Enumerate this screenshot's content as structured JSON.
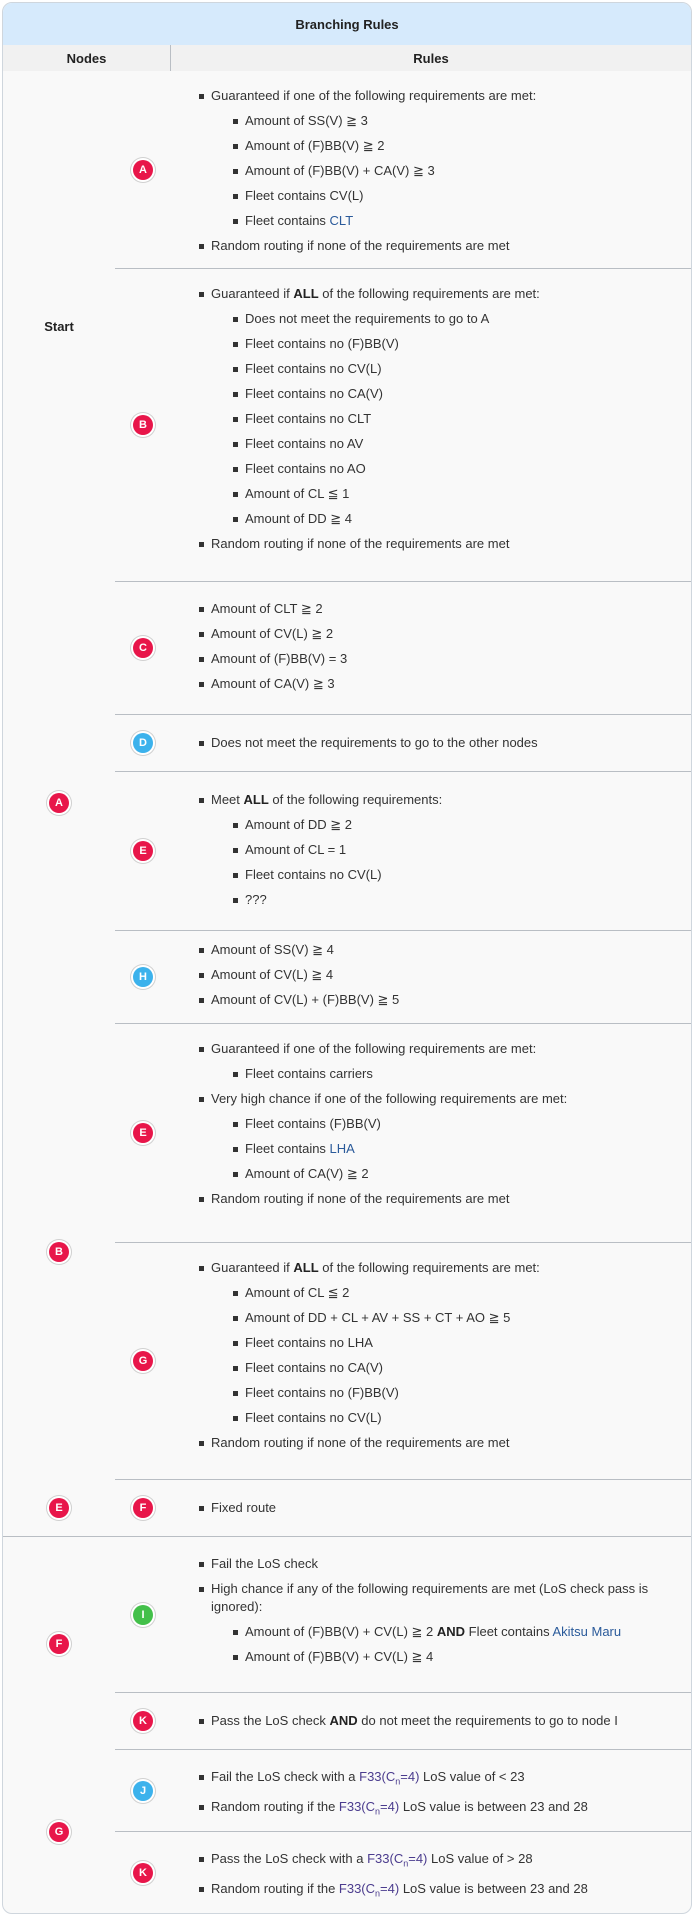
{
  "table": {
    "caption": "Branching Rules",
    "col_nodes": "Nodes",
    "col_rules": "Rules"
  },
  "rows": {
    "start_label": "Start",
    "startA": {
      "node": "A",
      "intro": "Guaranteed if one of the following requirements are met:",
      "items": [
        "Amount of SS(V) ≧ 3",
        "Amount of (F)BB(V) ≧ 2",
        "Amount of (F)BB(V) + CA(V) ≧ 3",
        "Fleet contains CV(L)",
        "Fleet contains "
      ],
      "clt": "CLT",
      "fallback": "Random routing if none of the requirements are met"
    },
    "startB": {
      "node": "B",
      "intro_pre": "Guaranteed if ",
      "intro_bold": "ALL",
      "intro_post": " of the following requirements are met:",
      "items": [
        "Does not meet the requirements to go to A",
        "Fleet contains no (F)BB(V)",
        "Fleet contains no CV(L)",
        "Fleet contains no CA(V)",
        "Fleet contains no CLT",
        "Fleet contains no AV",
        "Fleet contains no AO",
        "Amount of CL ≦ 1",
        "Amount of DD ≧ 4"
      ],
      "fallback": "Random routing if none of the requirements are met"
    },
    "A_label": "A",
    "AC": {
      "node": "C",
      "items": [
        "Amount of CLT ≧ 2",
        "Amount of CV(L) ≧ 2",
        "Amount of (F)BB(V) = 3",
        "Amount of CA(V) ≧ 3"
      ]
    },
    "AD": {
      "node": "D",
      "items": [
        "Does not meet the requirements to go to the other nodes"
      ]
    },
    "AE": {
      "node": "E",
      "intro_pre": "Meet ",
      "intro_bold": "ALL",
      "intro_post": " of the following requirements:",
      "items": [
        "Amount of DD ≧ 2",
        "Amount of CL = 1",
        "Fleet contains no CV(L)",
        "???"
      ]
    },
    "AH": {
      "node": "H",
      "items": [
        "Amount of SS(V) ≧ 4",
        "Amount of CV(L) ≧ 4",
        "Amount of CV(L) + (F)BB(V) ≧ 5"
      ]
    },
    "B_label": "B",
    "BE": {
      "node": "E",
      "intro1": "Guaranteed if one of the following requirements are met:",
      "items1": [
        "Fleet contains carriers"
      ],
      "intro2": "Very high chance if one of the following requirements are met:",
      "items2": [
        "Fleet contains (F)BB(V)",
        "Fleet contains ",
        "Amount of CA(V) ≧ 2"
      ],
      "lha": "LHA",
      "fallback": "Random routing if none of the requirements are met"
    },
    "BG": {
      "node": "G",
      "intro_pre": "Guaranteed if ",
      "intro_bold": "ALL",
      "intro_post": " of the following requirements are met:",
      "items": [
        "Amount of CL ≦ 2",
        "Amount of DD + CL + AV + SS + CT + AO ≧ 5",
        "Fleet contains no LHA",
        "Fleet contains no CA(V)",
        "Fleet contains no (F)BB(V)",
        "Fleet contains no CV(L)"
      ],
      "fallback": "Random routing if none of the requirements are met"
    },
    "E_label": "E",
    "EF": {
      "node": "F",
      "items": [
        "Fixed route"
      ]
    },
    "F_label": "F",
    "FI": {
      "node": "I",
      "item1": "Fail the LoS check",
      "item2": "High chance if any of the following requirements are met (LoS check pass is ignored):",
      "sub1_pre": "Amount of (F)BB(V) + CV(L) ≧ 2 ",
      "sub1_bold": "AND",
      "sub1_mid": " Fleet contains ",
      "sub1_link": "Akitsu Maru",
      "sub2": "Amount of (F)BB(V) + CV(L) ≧ 4"
    },
    "FK": {
      "node": "K",
      "pre": "Pass the LoS check ",
      "bold": "AND",
      "post": " do not meet the requirements to go to node I"
    },
    "G_label": "G",
    "GJ": {
      "node": "J",
      "f33": "F33(C",
      "f33sub": "n",
      "f33post": "=4)",
      "l1_pre": "Fail the LoS check with a ",
      "l1_post": " LoS value of < 23",
      "l2_pre": "Random routing if the ",
      "l2_post": " LoS value is between 23 and 28"
    },
    "GK": {
      "node": "K",
      "l1_pre": "Pass the LoS check with a ",
      "l1_post": " LoS value of > 28",
      "l2_pre": "Random routing if the ",
      "l2_post": " LoS value is between 23 and 28"
    }
  },
  "colors": {
    "red_node": "#e8164a",
    "blue_node": "#3cb2ec",
    "green_node": "#43c04a",
    "header_bg": "#d6eafc",
    "link": "#2a5a9a"
  }
}
